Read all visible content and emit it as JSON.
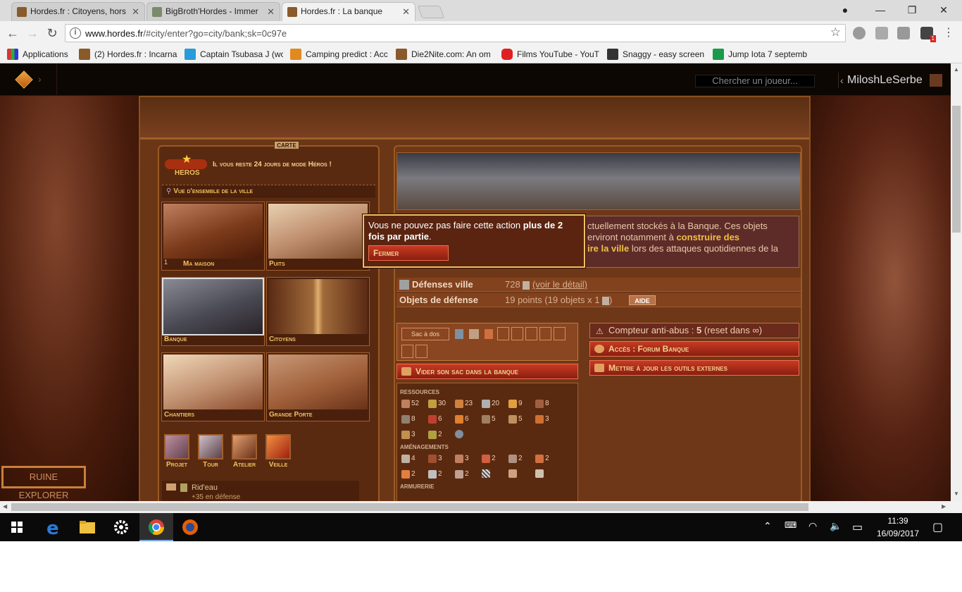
{
  "browser": {
    "tabs": [
      {
        "title": "Hordes.fr : Citoyens, hors",
        "active": false
      },
      {
        "title": "BigBroth'Hordes - Immer",
        "active": false
      },
      {
        "title": "Hordes.fr : La banque",
        "active": true
      }
    ],
    "url_host": "www.hordes.fr",
    "url_path": "/#city/enter?go=city/bank;sk=0c97e",
    "bookmarks": [
      "Applications",
      "(2) Hordes.fr : Incarna",
      "Captain Tsubasa J (wc",
      "Camping predict : Acc",
      "Die2Nite.com: An om",
      "Films YouTube - YouT",
      "Snaggy - easy screen",
      "Jump Iota 7 septemb"
    ],
    "ext_badge": "1"
  },
  "game": {
    "search_placeholder": "Chercher un joueur...",
    "username": "MiloshLeSerbe",
    "carte_label": "CARTE",
    "heros_label": "HEROS",
    "heros_text": "Il vous reste 24 jours de mode Héros !",
    "overview": "Vue d'ensemble de la ville",
    "tiles": [
      {
        "label": "Ma maison",
        "badge": "1"
      },
      {
        "label": "Puits"
      },
      {
        "label": "Banque"
      },
      {
        "label": "Citoyens"
      },
      {
        "label": "Chantiers"
      },
      {
        "label": "Grande Porte"
      }
    ],
    "buildings": [
      "Projet",
      "Tour",
      "Atelier",
      "Veille"
    ],
    "rideau_title": "Rid'eau",
    "rideau_sub": "+35 en défense",
    "bank_desc_a": "ctuellement stockés à la Banque. Ces objets",
    "bank_desc_b": "erviront notamment à ",
    "bank_desc_b_bold": "construire des",
    "bank_desc_c_bold": "ire la ville",
    "bank_desc_c": " lors des attaques quotidiennes de la",
    "def_ville_label": "Défenses ville",
    "def_ville_value": "728",
    "def_ville_link": "(voir le détail)",
    "obj_def_label": "Objets de défense",
    "obj_def_value": "19 points (19 objets x 1",
    "obj_def_close": ")",
    "aide": "AIDE",
    "sac_label": "Sac à dos",
    "vider": "Vider son sac dans la banque",
    "anti_label": "Compteur anti-abus : ",
    "anti_value": "5",
    "anti_suffix": " (reset dans ∞)",
    "forum": "Accès : Forum Banque",
    "outils": "Mettre à jour les outils externes",
    "cat_ressources": "RESSOURCES",
    "cat_amenagements": "AMÉNAGEMENTS",
    "cat_armurerie": "ARMURERIE",
    "ressources": [
      "52",
      "30",
      "23",
      "20",
      "9",
      "8",
      "8",
      "6",
      "6",
      "5",
      "5",
      "3",
      "3",
      "2"
    ],
    "amenagements": [
      "4",
      "3",
      "3",
      "2",
      "2",
      "2",
      "2",
      "2",
      "2"
    ],
    "popup_text": "Vous ne pouvez pas faire cette action ",
    "popup_bold": "plus de 2 fois par partie",
    "popup_end": ".",
    "fermer": "Fermer",
    "ruine": "RUINE EXPLORER"
  },
  "taskbar": {
    "time": "11:39",
    "date": "16/09/2017"
  }
}
